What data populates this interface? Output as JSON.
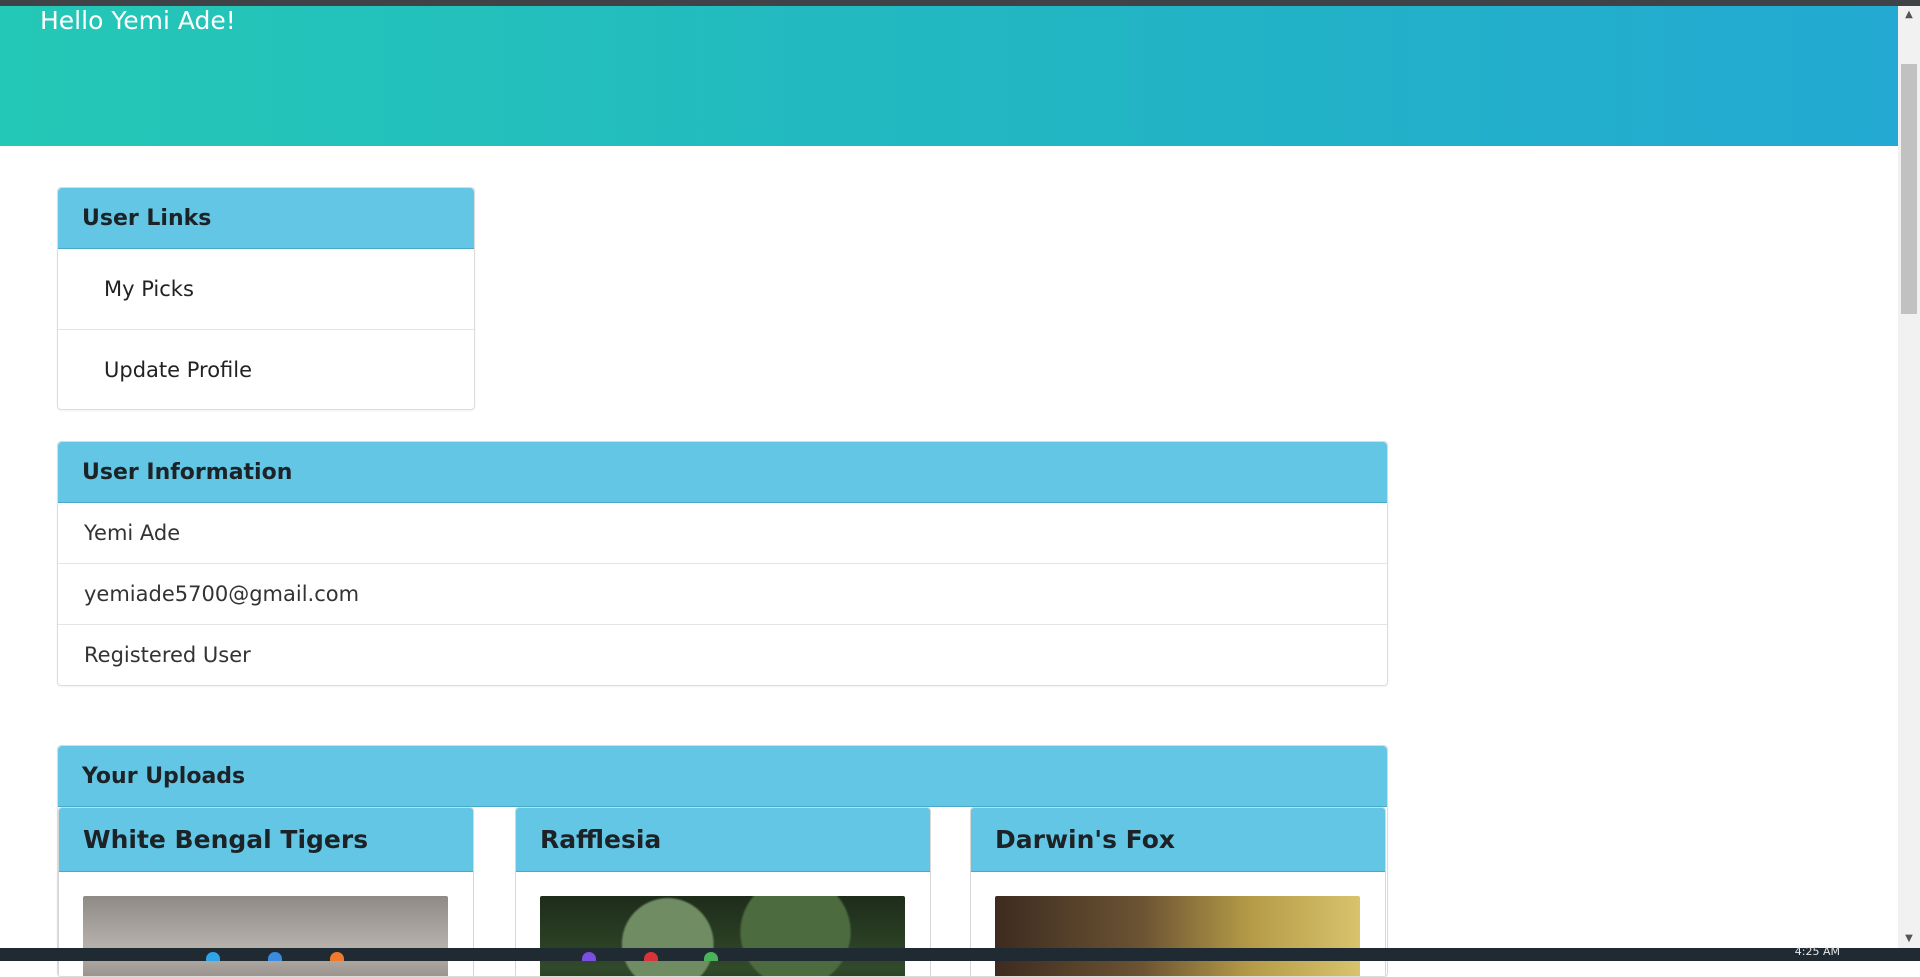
{
  "header": {
    "greeting": "Hello Yemi Ade!"
  },
  "user_links": {
    "title": "User Links",
    "items": [
      {
        "label": "My Picks"
      },
      {
        "label": "Update Profile"
      }
    ]
  },
  "user_info": {
    "title": "User Information",
    "name": "Yemi Ade",
    "email": "yemiade5700@gmail.com",
    "role": "Registered User"
  },
  "uploads": {
    "title": "Your Uploads",
    "cards": [
      {
        "title": "White Bengal Tigers"
      },
      {
        "title": "Rafflesia"
      },
      {
        "title": "Darwin's Fox"
      }
    ]
  },
  "taskbar": {
    "clock": "4:25 AM"
  },
  "colors": {
    "banner_start": "#24c8b6",
    "banner_end": "#23a9d2",
    "panel_header": "#62c6e4"
  }
}
